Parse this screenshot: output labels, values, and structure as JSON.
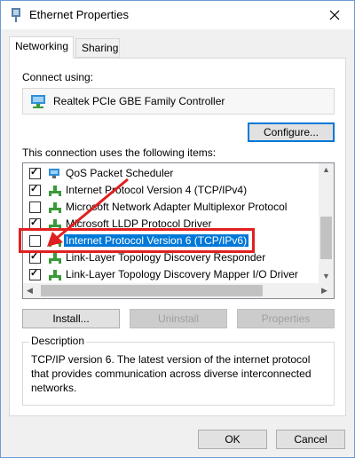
{
  "window": {
    "title": "Ethernet Properties",
    "close_label": "×"
  },
  "tabs": [
    {
      "label": "Networking",
      "active": true
    },
    {
      "label": "Sharing",
      "active": false
    }
  ],
  "connect_using": {
    "label": "Connect using:",
    "adapter_name": "Realtek PCIe GBE Family Controller",
    "configure_label": "Configure..."
  },
  "items_section": {
    "label": "This connection uses the following items:",
    "items": [
      {
        "label": "QoS Packet Scheduler",
        "checked": true,
        "icon": "scheduler-icon"
      },
      {
        "label": "Internet Protocol Version 4 (TCP/IPv4)",
        "checked": true,
        "icon": "protocol-icon"
      },
      {
        "label": "Microsoft Network Adapter Multiplexor Protocol",
        "checked": false,
        "icon": "protocol-icon"
      },
      {
        "label": "Microsoft LLDP Protocol Driver",
        "checked": true,
        "icon": "protocol-icon"
      },
      {
        "label": "Internet Protocol Version 6 (TCP/IPv6)",
        "checked": false,
        "icon": "protocol-icon",
        "selected": true
      },
      {
        "label": "Link-Layer Topology Discovery Responder",
        "checked": true,
        "icon": "protocol-icon"
      },
      {
        "label": "Link-Layer Topology Discovery Mapper I/O Driver",
        "checked": true,
        "icon": "protocol-icon"
      }
    ]
  },
  "buttons": {
    "install": "Install...",
    "uninstall": "Uninstall",
    "properties": "Properties",
    "ok": "OK",
    "cancel": "Cancel"
  },
  "description": {
    "legend": "Description",
    "text": "TCP/IP version 6. The latest version of the internet protocol that provides communication across diverse interconnected networks."
  },
  "colors": {
    "accent": "#0078d7",
    "highlight": "#e02020"
  }
}
